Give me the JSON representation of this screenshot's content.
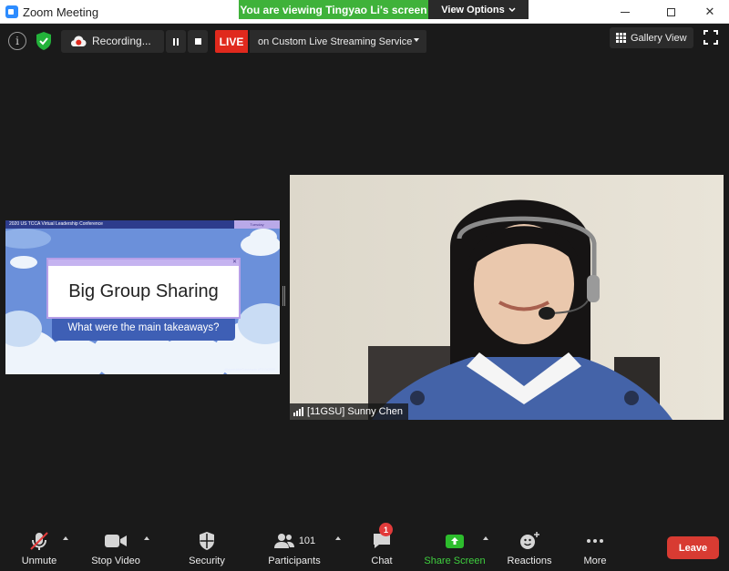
{
  "window": {
    "title": "Zoom Meeting"
  },
  "share_banner": {
    "text": "You are viewing Tingyao Li's screen",
    "view_options": "View Options"
  },
  "top_bar": {
    "recording_label": "Recording...",
    "live_badge": "LIVE",
    "live_service": "on Custom Live Streaming Service",
    "gallery_view": "Gallery View"
  },
  "shared_slide": {
    "conference": "2020 US TCCA Virtual Leadership Conference",
    "tag": "Tuesday",
    "title": "Big Group Sharing",
    "subtitle": "What were the main takeaways?",
    "footer": "#BeyondtheClassroom #TCCA2020"
  },
  "video": {
    "participant_name": "[11GSU] Sunny Chen"
  },
  "toolbar": {
    "unmute": "Unmute",
    "stop_video": "Stop Video",
    "security": "Security",
    "participants": "Participants",
    "participant_count": "101",
    "chat": "Chat",
    "chat_badge": "1",
    "share_screen": "Share Screen",
    "reactions": "Reactions",
    "more": "More",
    "leave": "Leave"
  },
  "colors": {
    "share_green": "#3fb23a",
    "live_red": "#e0291d",
    "leave_red": "#d83b32",
    "zoom_blue": "#2d8cff"
  }
}
